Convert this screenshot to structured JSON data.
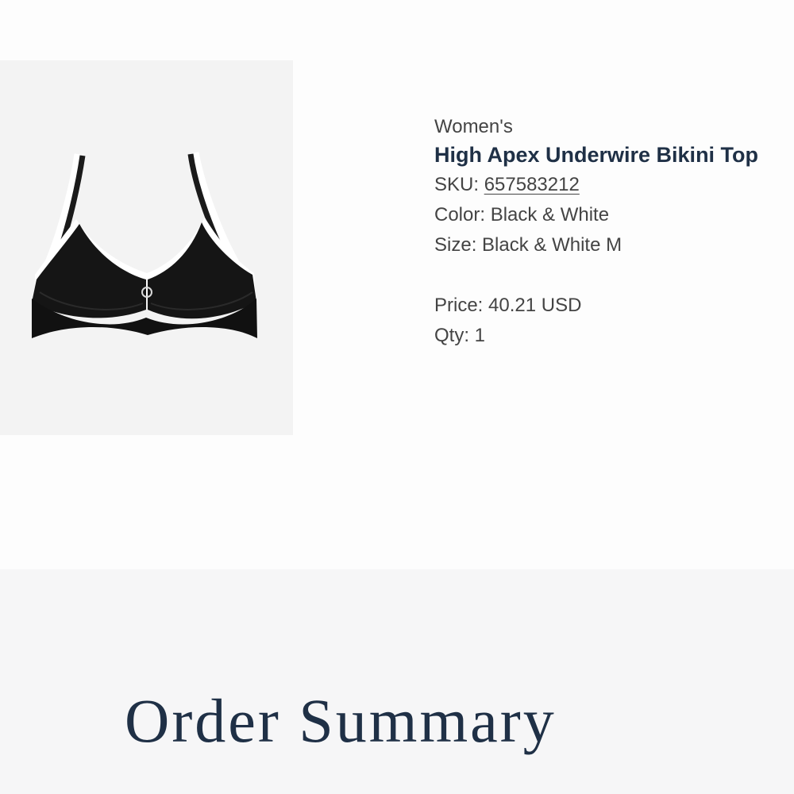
{
  "product": {
    "category": "Women's",
    "title": "High Apex Underwire Bikini Top",
    "sku_label": "SKU: ",
    "sku_value": "657583212",
    "color_label": "Color: ",
    "color_value": "Black & White",
    "size_label": "Size: ",
    "size_value": "Black & White M",
    "price_label": "Price: ",
    "price_value": "40.21 USD",
    "qty_label": "Qty: ",
    "qty_value": "1",
    "image": {
      "icon": "bikini-top-image",
      "garment_color": "#111111",
      "trim_color": "#ffffff",
      "background": "#f3f3f3"
    }
  },
  "summary": {
    "title": "Order Summary"
  },
  "colors": {
    "title_navy": "#1f3046",
    "text_gray": "#444444",
    "band_background": "#f6f6f7"
  }
}
